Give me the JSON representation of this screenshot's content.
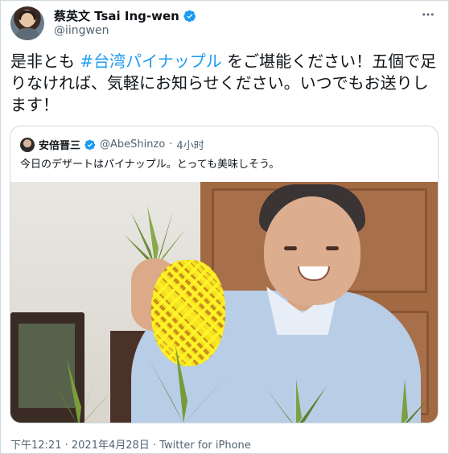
{
  "author": {
    "display_name": "蔡英文 Tsai Ing-wen",
    "handle": "@iingwen",
    "verified": true
  },
  "tweet": {
    "text_before": "是非とも ",
    "hashtag": "#台湾パイナップル",
    "text_after": " をご堪能ください！五個で足りなければ、気軽にお知らせください。いつでもお送りします！"
  },
  "quoted": {
    "display_name": "安倍晋三",
    "handle": "@AbeShinzo",
    "separator": " · ",
    "time": "4小时",
    "text": "今日のデザートはパイナップル。とっても美味しそう。"
  },
  "footer": {
    "time": "下午12:21",
    "date": "2021年4月28日",
    "source": "Twitter for iPhone",
    "sep": " · "
  },
  "icons": {
    "verified": "verified-badge-icon",
    "more": "more-options-icon"
  },
  "colors": {
    "accent": "#1d9bf0",
    "secondary_text": "#536471",
    "border": "#cfd9de"
  }
}
